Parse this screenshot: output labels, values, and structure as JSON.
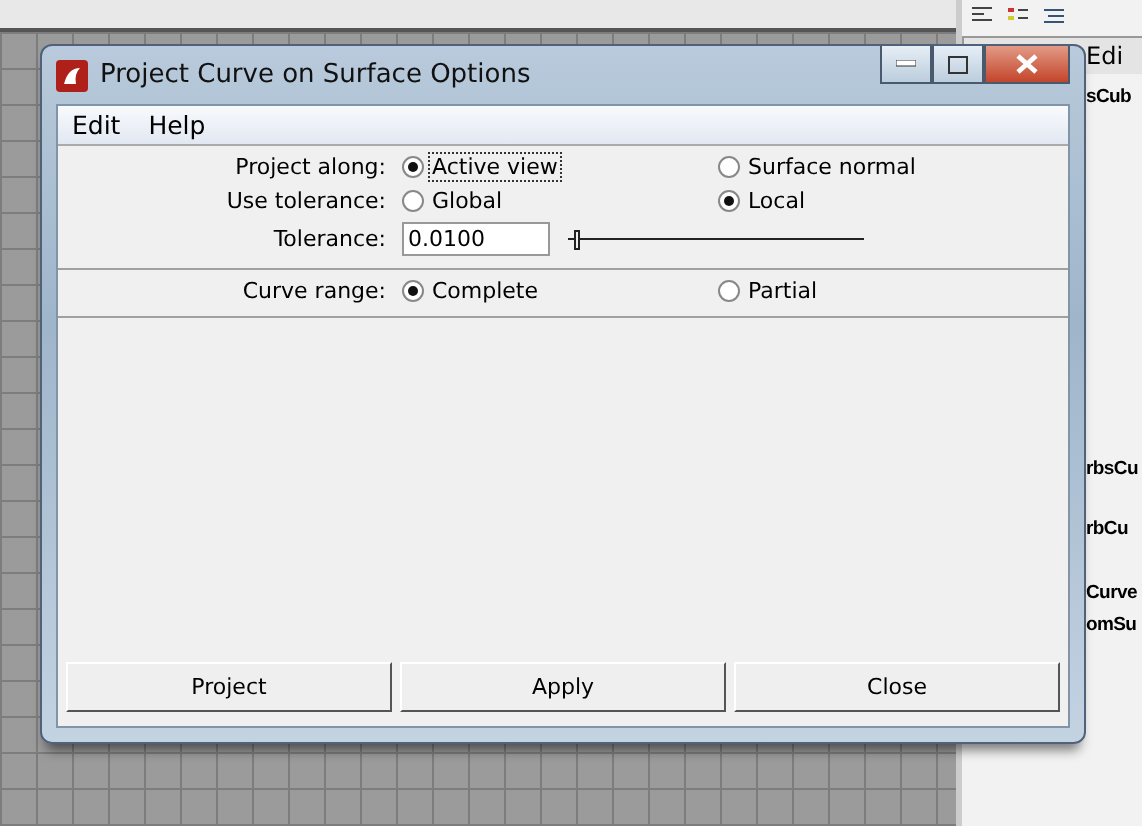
{
  "window": {
    "title": "Project Curve on Surface Options"
  },
  "menu": [
    {
      "label": "Edit"
    },
    {
      "label": "Help"
    }
  ],
  "sections": [
    [
      {
        "kind": "radio",
        "label": "Project along:",
        "options": [
          {
            "label": "Active view",
            "selected": true,
            "focused": true
          },
          {
            "label": "Surface normal",
            "selected": false,
            "focused": false
          }
        ]
      },
      {
        "kind": "radio",
        "label": "Use tolerance:",
        "options": [
          {
            "label": "Global",
            "selected": false,
            "focused": false
          },
          {
            "label": "Local",
            "selected": true,
            "focused": false
          }
        ]
      },
      {
        "kind": "slider",
        "label": "Tolerance:",
        "value": "0.0100",
        "level": 0.02
      }
    ],
    [
      {
        "kind": "radio",
        "label": "Curve range:",
        "options": [
          {
            "label": "Complete",
            "selected": true,
            "focused": false
          },
          {
            "label": "Partial",
            "selected": false,
            "focused": false
          }
        ]
      }
    ]
  ],
  "buttons": [
    {
      "label": "Project"
    },
    {
      "label": "Apply"
    },
    {
      "label": "Close"
    }
  ],
  "side_panel": {
    "tab": "Edi",
    "items": [
      {
        "label": "sCub"
      },
      {
        "label": "rbsCu"
      },
      {
        "label": "rbCu"
      },
      {
        "label": "Curve"
      },
      {
        "label": "omSu"
      }
    ]
  }
}
